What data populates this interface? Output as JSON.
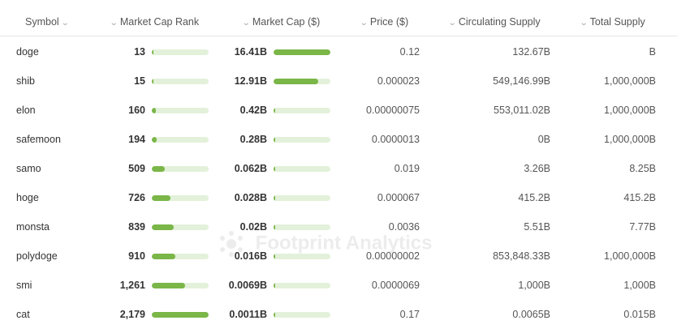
{
  "columns": [
    {
      "label": "Symbol"
    },
    {
      "label": "Market Cap Rank"
    },
    {
      "label": "Market Cap ($)"
    },
    {
      "label": "Price ($)"
    },
    {
      "label": "Circulating Supply"
    },
    {
      "label": "Total Supply"
    }
  ],
  "rows": [
    {
      "symbol": "doge",
      "rank": "13",
      "rank_pct": 0.006,
      "market_cap": "16.41B",
      "cap_pct": 1.0,
      "price": "0.12",
      "circulating": "132.67B",
      "total": "B"
    },
    {
      "symbol": "shib",
      "rank": "15",
      "rank_pct": 0.007,
      "market_cap": "12.91B",
      "cap_pct": 0.787,
      "price": "0.000023",
      "circulating": "549,146.99B",
      "total": "1,000,000B"
    },
    {
      "symbol": "elon",
      "rank": "160",
      "rank_pct": 0.073,
      "market_cap": "0.42B",
      "cap_pct": 0.026,
      "price": "0.00000075",
      "circulating": "553,011.02B",
      "total": "1,000,000B"
    },
    {
      "symbol": "safemoon",
      "rank": "194",
      "rank_pct": 0.089,
      "market_cap": "0.28B",
      "cap_pct": 0.017,
      "price": "0.0000013",
      "circulating": "0B",
      "total": "1,000,000B"
    },
    {
      "symbol": "samo",
      "rank": "509",
      "rank_pct": 0.234,
      "market_cap": "0.062B",
      "cap_pct": 0.004,
      "price": "0.019",
      "circulating": "3.26B",
      "total": "8.25B"
    },
    {
      "symbol": "hoge",
      "rank": "726",
      "rank_pct": 0.333,
      "market_cap": "0.028B",
      "cap_pct": 0.002,
      "price": "0.000067",
      "circulating": "415.2B",
      "total": "415.2B"
    },
    {
      "symbol": "monsta",
      "rank": "839",
      "rank_pct": 0.385,
      "market_cap": "0.02B",
      "cap_pct": 0.001,
      "price": "0.0036",
      "circulating": "5.51B",
      "total": "7.77B"
    },
    {
      "symbol": "polydoge",
      "rank": "910",
      "rank_pct": 0.418,
      "market_cap": "0.016B",
      "cap_pct": 0.001,
      "price": "0.00000002",
      "circulating": "853,848.33B",
      "total": "1,000,000B"
    },
    {
      "symbol": "smi",
      "rank": "1,261",
      "rank_pct": 0.579,
      "market_cap": "0.0069B",
      "cap_pct": 0.0004,
      "price": "0.0000069",
      "circulating": "1,000B",
      "total": "1,000B"
    },
    {
      "symbol": "cat",
      "rank": "2,179",
      "rank_pct": 1.0,
      "market_cap": "0.0011B",
      "cap_pct": 0.0001,
      "price": "0.17",
      "circulating": "0.0065B",
      "total": "0.015B"
    }
  ],
  "watermark": "Footprint Analytics",
  "colors": {
    "bar_fill": "#7ab648",
    "bar_track": "#e3f1da"
  }
}
